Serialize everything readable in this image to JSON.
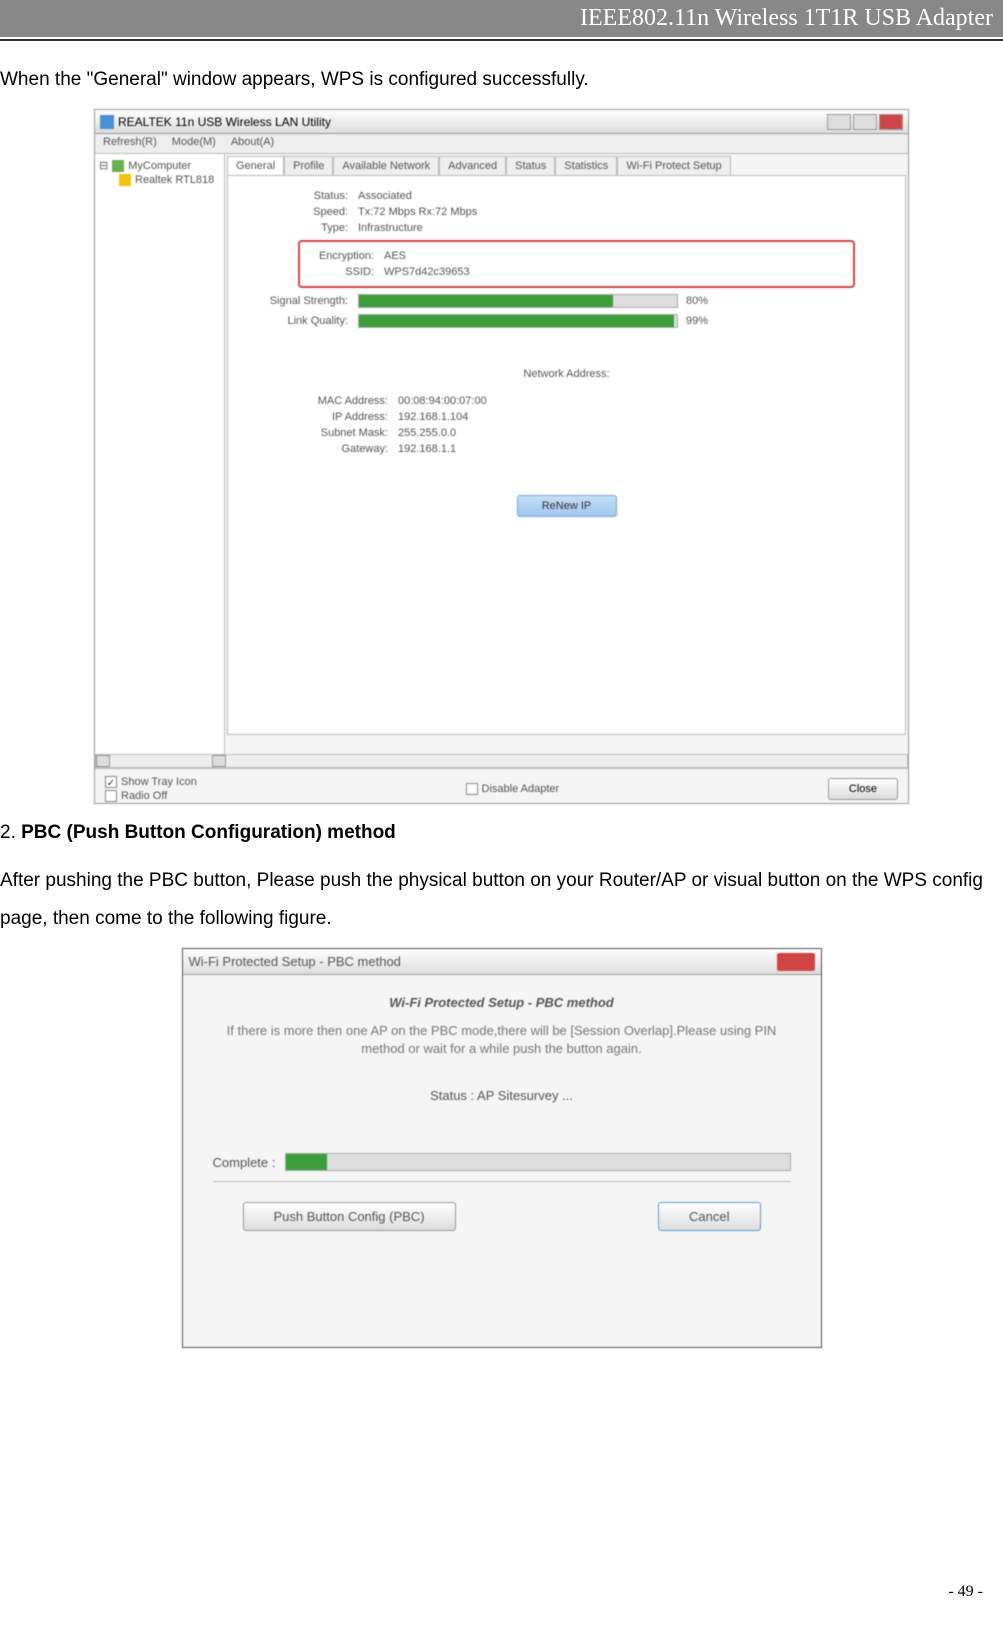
{
  "header": {
    "title": "IEEE802.11n Wireless 1T1R USB Adapter"
  },
  "text": {
    "intro": "When the \"General\" window appears, WPS is configured successfully.",
    "section2_prefix": "2. ",
    "section2_bold": "PBC (Push Button Configuration) method",
    "pbc_para": "After pushing the PBC button, Please push the physical button on your Router/AP or visual button on the WPS config page, then come to the following figure."
  },
  "utility": {
    "title": "REALTEK 11n USB Wireless LAN Utility",
    "menu": {
      "refresh": "Refresh(R)",
      "mode": "Mode(M)",
      "about": "About(A)"
    },
    "tree": {
      "root": "MyComputer",
      "device": "Realtek RTL818"
    },
    "tabs": {
      "general": "General",
      "profile": "Profile",
      "available": "Available Network",
      "advanced": "Advanced",
      "status": "Status",
      "statistics": "Statistics",
      "wps": "Wi-Fi Protect Setup"
    },
    "status": {
      "status_label": "Status:",
      "status_value": "Associated",
      "speed_label": "Speed:",
      "speed_value": "Tx:72 Mbps Rx:72 Mbps",
      "type_label": "Type:",
      "type_value": "Infrastructure",
      "encryption_label": "Encryption:",
      "encryption_value": "AES",
      "ssid_label": "SSID:",
      "ssid_value": "WPS7d42c39653",
      "signal_label": "Signal Strength:",
      "signal_pct": "80%",
      "link_label": "Link Quality:",
      "link_pct": "99%"
    },
    "network": {
      "heading": "Network Address:",
      "mac_label": "MAC Address:",
      "mac_value": "00:08:94:00:07:00",
      "ip_label": "IP Address:",
      "ip_value": "192.168.1.104",
      "subnet_label": "Subnet Mask:",
      "subnet_value": "255.255.0.0",
      "gateway_label": "Gateway:",
      "gateway_value": "192.168.1.1",
      "renew_btn": "ReNew IP"
    },
    "bottom": {
      "show_tray": "Show Tray Icon",
      "radio_off": "Radio Off",
      "disable_adapter": "Disable Adapter",
      "close": "Close"
    }
  },
  "pbc": {
    "title": "Wi-Fi Protected Setup - PBC method",
    "heading": "Wi-Fi Protected Setup - PBC method",
    "info": "If there is more then one AP on the PBC mode,there will be [Session Overlap].Please using PIN method or wait for a while push the button again.",
    "status": "Status : AP Sitesurvey ...",
    "complete": "Complete :",
    "pbc_btn": "Push Button Config (PBC)",
    "cancel_btn": "Cancel"
  },
  "page_number": "- 49 -"
}
